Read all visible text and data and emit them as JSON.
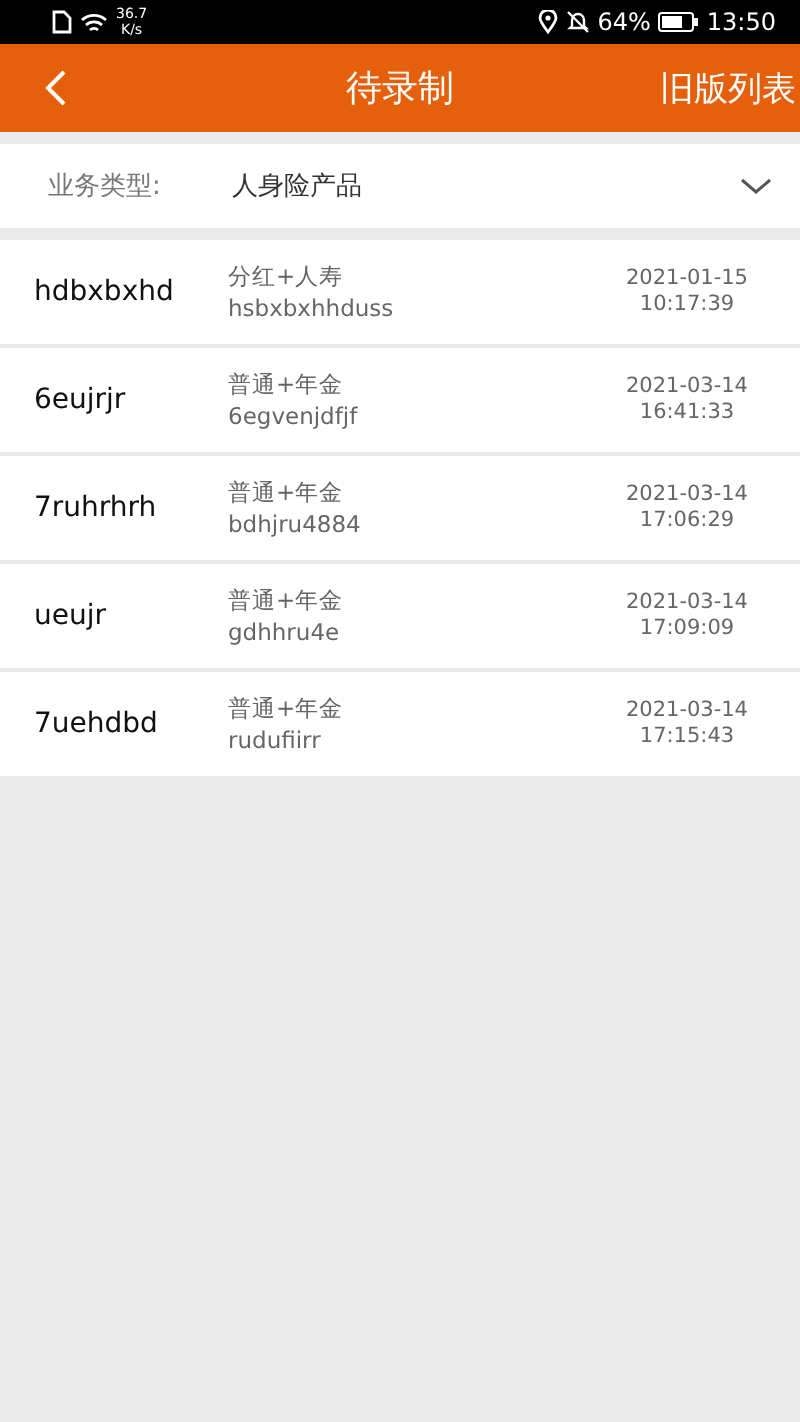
{
  "status_bar": {
    "speed_value": "36.7",
    "speed_unit": "K/s",
    "battery": "64%",
    "time": "13:50"
  },
  "header": {
    "title": "待录制",
    "action": "旧版列表"
  },
  "filter": {
    "label": "业务类型:",
    "value": "人身险产品"
  },
  "rows": [
    {
      "name": "hdbxbxhd",
      "product": "分红+人寿",
      "code": "hsbxbxhhduss",
      "date": "2021-01-15",
      "time": "10:17:39"
    },
    {
      "name": "6eujrjr",
      "product": "普通+年金",
      "code": "6egvenjdfjf",
      "date": "2021-03-14",
      "time": "16:41:33"
    },
    {
      "name": "7ruhrhrh",
      "product": "普通+年金",
      "code": "bdhjru4884",
      "date": "2021-03-14",
      "time": "17:06:29"
    },
    {
      "name": "ueujr",
      "product": "普通+年金",
      "code": "gdhhru4e",
      "date": "2021-03-14",
      "time": "17:09:09"
    },
    {
      "name": "7uehdbd",
      "product": "普通+年金",
      "code": "rudufiirr",
      "date": "2021-03-14",
      "time": "17:15:43"
    }
  ]
}
